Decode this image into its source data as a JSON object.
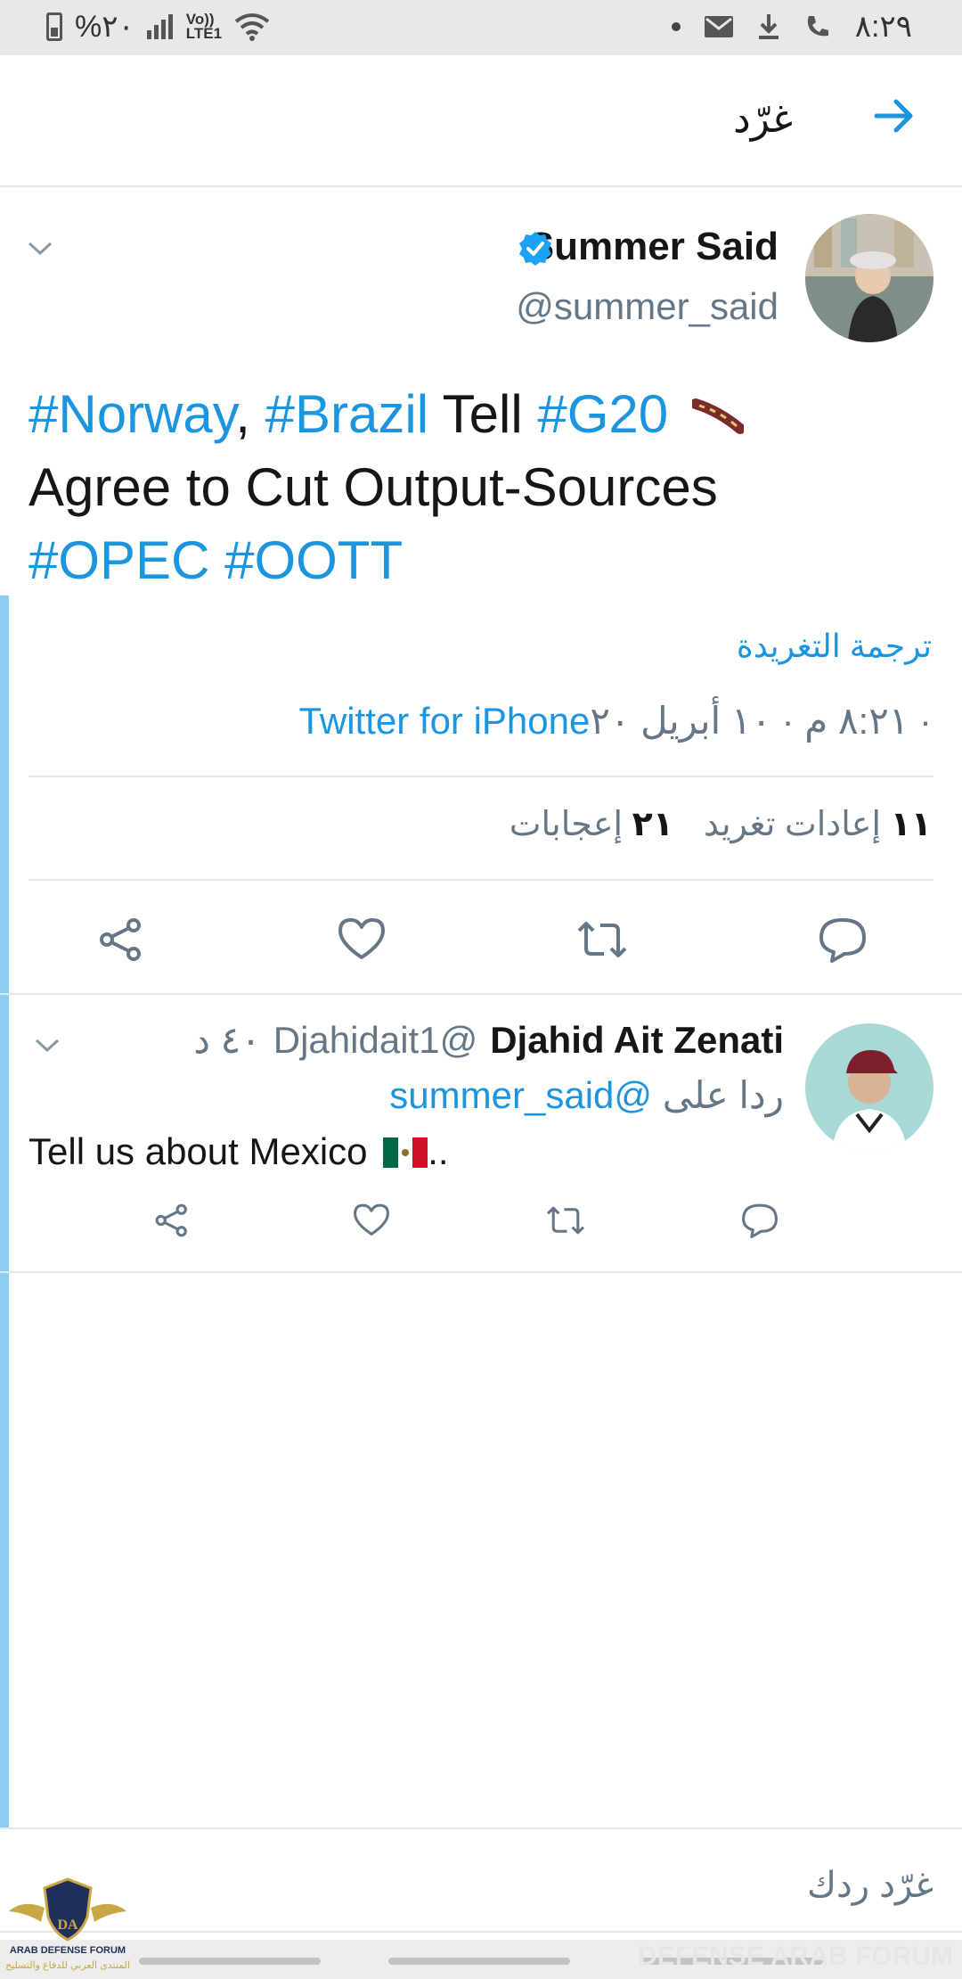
{
  "status_bar": {
    "battery_text": "%٢٠",
    "network": "LTE1",
    "volte": "Vo))",
    "time": "٨:٢٩"
  },
  "header": {
    "title": "غرّد"
  },
  "tweet": {
    "author_name": "Summer Said",
    "author_handle": "@summer_said",
    "text": {
      "t1": "#Norway",
      "t2": ", ",
      "t3": "#Brazil",
      "t4": " Tell ",
      "t5": "#G20",
      "t6": "Agree to Cut Output-Sources",
      "t7": "#OPEC #OOTT"
    },
    "translate_label": "ترجمة التغريدة",
    "timestamp": "٨:٢١ م · ١٠ أبريل ٢٠ · ",
    "source": "Twitter for iPhone",
    "retweets_count": "١١",
    "retweets_label": "إعادات تغريد",
    "likes_count": "٢١",
    "likes_label": "إعجابات"
  },
  "reply": {
    "author_name": "Djahid Ait Zenati",
    "author_handle": "@Djahidait1",
    "time": "٤٠ د",
    "replying_prefix": "ردا على",
    "replying_to": "@summer_said",
    "text": "Tell us about Mexico",
    "text_suffix": ".."
  },
  "compose": {
    "placeholder": "غرّد ردك"
  },
  "watermark": {
    "logo_title": "ARAB DEFENSE FORUM",
    "logo_sub": "المنتدى العربي للدفاع والتسليح",
    "right_text": "DEFENSE ARAB FORUM"
  },
  "colors": {
    "link": "#1b95e0",
    "muted": "#657786",
    "accent_bar": "#8ecdf2",
    "divider": "#e1e8ed"
  }
}
